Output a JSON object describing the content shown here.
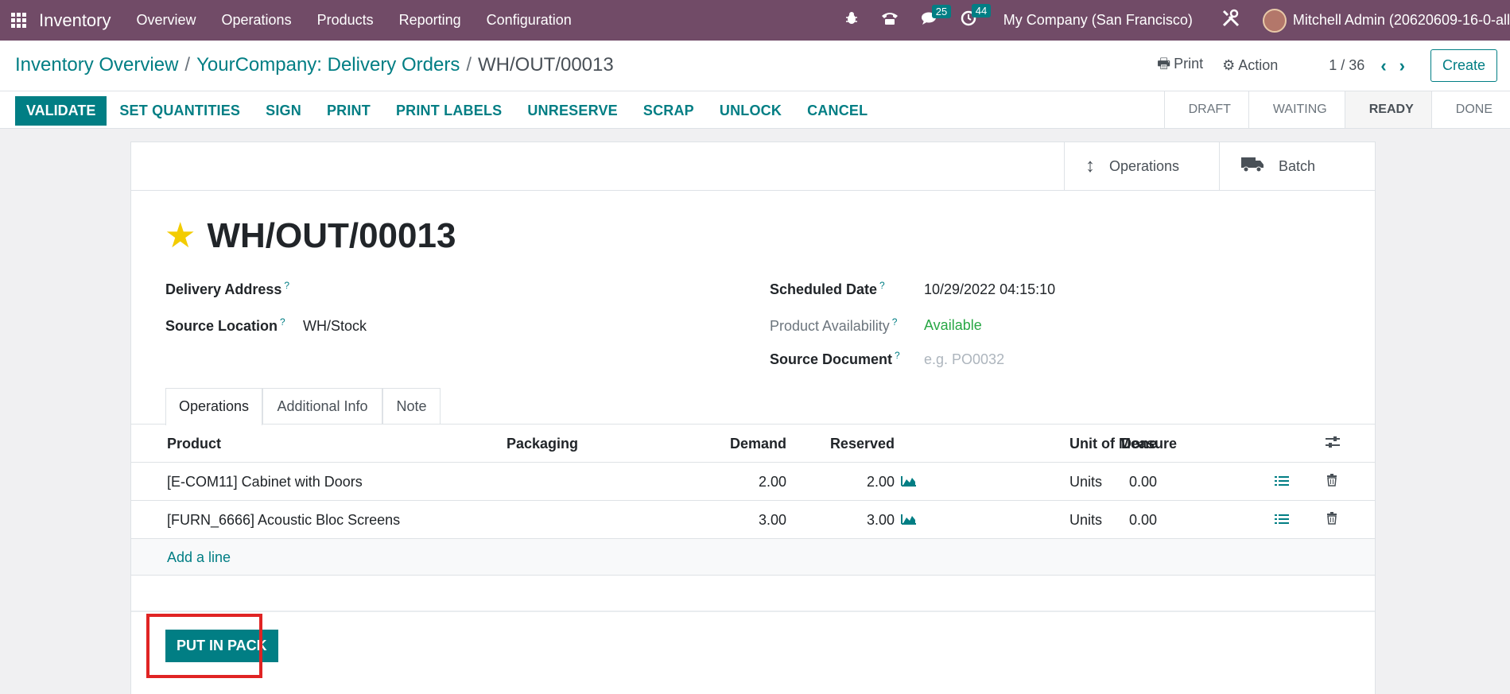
{
  "navbar": {
    "app_name": "Inventory",
    "menu": [
      "Overview",
      "Operations",
      "Products",
      "Reporting",
      "Configuration"
    ],
    "messages_count": "25",
    "activities_count": "44",
    "company": "My Company (San Francisco)",
    "user": "Mitchell Admin (20620609-16-0-all"
  },
  "breadcrumb": {
    "first": "Inventory Overview",
    "second": "YourCompany: Delivery Orders",
    "current": "WH/OUT/00013"
  },
  "control": {
    "print_label": "Print",
    "action_label": "Action",
    "pager": "1 / 36",
    "create_label": "Create"
  },
  "actions": [
    "VALIDATE",
    "SET QUANTITIES",
    "SIGN",
    "PRINT",
    "PRINT LABELS",
    "UNRESERVE",
    "SCRAP",
    "UNLOCK",
    "CANCEL"
  ],
  "stages": [
    "DRAFT",
    "WAITING",
    "READY",
    "DONE"
  ],
  "active_stage": "READY",
  "smart_buttons": {
    "operations": "Operations",
    "batch": "Batch"
  },
  "record": {
    "name": "WH/OUT/00013",
    "delivery_address_label": "Delivery Address",
    "source_location_label": "Source Location",
    "source_location_value": "WH/Stock",
    "scheduled_date_label": "Scheduled Date",
    "scheduled_date_value": "10/29/2022 04:15:10",
    "availability_label": "Product Availability",
    "availability_value": "Available",
    "source_document_label": "Source Document",
    "source_document_placeholder": "e.g. PO0032",
    "help_mark": "?"
  },
  "tabs": [
    "Operations",
    "Additional Info",
    "Note"
  ],
  "table": {
    "headers": {
      "product": "Product",
      "packaging": "Packaging",
      "demand": "Demand",
      "reserved": "Reserved",
      "done": "Done",
      "uom": "Unit of Measure"
    },
    "rows": [
      {
        "product": "[E-COM11] Cabinet with Doors",
        "demand": "2.00",
        "reserved": "2.00",
        "done": "0.00",
        "uom": "Units"
      },
      {
        "product": "[FURN_6666] Acoustic Bloc Screens",
        "demand": "3.00",
        "reserved": "3.00",
        "done": "0.00",
        "uom": "Units"
      }
    ],
    "add_line": "Add a line"
  },
  "footer": {
    "put_in_pack": "PUT IN PACK"
  },
  "colors": {
    "navbar": "#714b67",
    "primary": "#017e84",
    "highlight": "#e02424",
    "star": "#f3cc00"
  }
}
